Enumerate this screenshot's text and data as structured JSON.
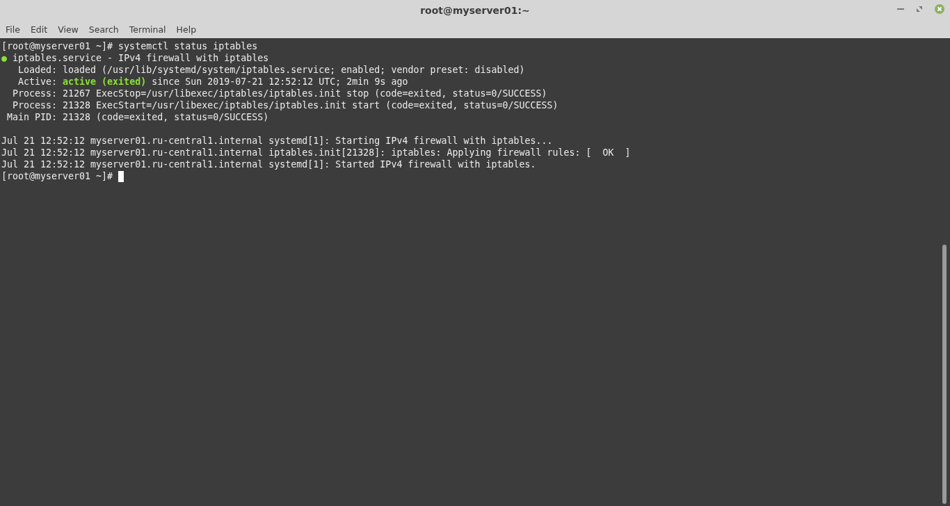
{
  "window": {
    "title": "root@myserver01:~"
  },
  "menu": [
    "File",
    "Edit",
    "View",
    "Search",
    "Terminal",
    "Help"
  ],
  "terminal": {
    "lines": [
      {
        "segments": [
          {
            "text": "[root@myserver01 ~]# systemctl status iptables"
          }
        ]
      },
      {
        "segments": [
          {
            "text": "●",
            "color": "#8ae234"
          },
          {
            "text": " iptables.service - IPv4 firewall with iptables"
          }
        ]
      },
      {
        "segments": [
          {
            "text": "   Loaded: loaded (/usr/lib/systemd/system/iptables.service; enabled; vendor preset: disabled)"
          }
        ]
      },
      {
        "segments": [
          {
            "text": "   Active: "
          },
          {
            "text": "active (exited)",
            "color": "#8ae234",
            "bold": true
          },
          {
            "text": " since Sun 2019-07-21 12:52:12 UTC; 2min 9s ago"
          }
        ]
      },
      {
        "segments": [
          {
            "text": "  Process: 21267 ExecStop=/usr/libexec/iptables/iptables.init stop (code=exited, status=0/SUCCESS)"
          }
        ]
      },
      {
        "segments": [
          {
            "text": "  Process: 21328 ExecStart=/usr/libexec/iptables/iptables.init start (code=exited, status=0/SUCCESS)"
          }
        ]
      },
      {
        "segments": [
          {
            "text": " Main PID: 21328 (code=exited, status=0/SUCCESS)"
          }
        ]
      },
      {
        "blank": true
      },
      {
        "segments": [
          {
            "text": "Jul 21 12:52:12 myserver01.ru-central1.internal systemd[1]: Starting IPv4 firewall with iptables..."
          }
        ]
      },
      {
        "segments": [
          {
            "text": "Jul 21 12:52:12 myserver01.ru-central1.internal iptables.init[21328]: iptables: Applying firewall rules: [  OK  ]"
          }
        ]
      },
      {
        "segments": [
          {
            "text": "Jul 21 12:52:12 myserver01.ru-central1.internal systemd[1]: Started IPv4 firewall with iptables."
          }
        ]
      },
      {
        "segments": [
          {
            "text": "[root@myserver01 ~]# "
          }
        ],
        "cursor": true
      }
    ]
  }
}
